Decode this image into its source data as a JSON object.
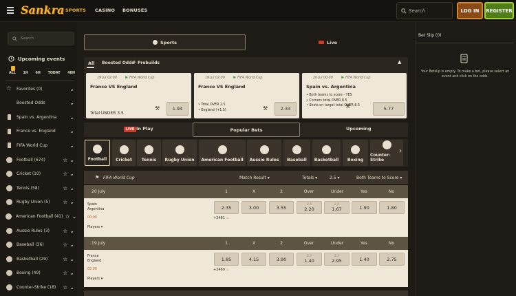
{
  "header": {
    "brand": "Sankra",
    "nav": [
      "SPORTS",
      "CASINO",
      "BONUSES"
    ],
    "search_placeholder": "Search",
    "login": "LOG IN",
    "register": "REGISTER"
  },
  "sidebar": {
    "search_placeholder": "Search",
    "upcoming_title": "Upcoming events",
    "filters": [
      "ALL",
      "1H",
      "6H",
      "TODAY",
      "48H"
    ],
    "items": [
      {
        "label": "Favorites (0)",
        "chev": true
      },
      {
        "label": "Boosted Odds"
      },
      {
        "label": "Spain vs. Argentina",
        "chev": true
      },
      {
        "label": "France vs. England",
        "chev": true
      },
      {
        "label": "FIFA World Cup",
        "chev": true
      },
      {
        "label": "Football (674)",
        "star": true
      },
      {
        "label": "Cricket (10)",
        "star": true
      },
      {
        "label": "Tennis (58)",
        "star": true
      },
      {
        "label": "Rugby Union (5)",
        "star": true
      },
      {
        "label": "American Football (41)",
        "star": true
      },
      {
        "label": "Aussie Rules (3)",
        "star": true
      },
      {
        "label": "Baseball (36)",
        "star": true
      },
      {
        "label": "Basketball (29)",
        "star": true
      },
      {
        "label": "Boxing (49)",
        "star": true
      },
      {
        "label": "Counter-Strike (18)",
        "star": true
      }
    ]
  },
  "main": {
    "tab_sports": "Sports",
    "tab_live": "Live",
    "subtabs": [
      "All",
      "Boosted Odds",
      "Prebuilds"
    ],
    "cards": [
      {
        "time": "19 Jul 02:00",
        "comp": "FIFA World Cup",
        "match": "France VS England",
        "foot": "Total UNDER 3.5",
        "odds": "1.94"
      },
      {
        "time": "19 Jul 02:00",
        "comp": "FIFA World Cup",
        "match": "France VS England",
        "lines": [
          "Total OVER 2.5",
          "England (+1.5)"
        ],
        "odds": "2.33"
      },
      {
        "time": "20 Jul 00:00",
        "comp": "FIFA World Cup",
        "match": "Spain vs. Argentina",
        "lines": [
          "Both teams to score - YES",
          "Corners total OVER 8.5",
          "Shots on target total OVER 8.5"
        ],
        "odds": "5.77"
      }
    ],
    "bettabs": {
      "live_badge": "LIVE",
      "in_play": "In Play",
      "popular": "Popular Bets",
      "upcoming": "Upcoming"
    },
    "sports": [
      "Football",
      "Cricket",
      "Tennis",
      "Rugby Union",
      "American Football",
      "Aussie Rules",
      "Baseball",
      "Basketball",
      "Boxing",
      "Counter-Strike"
    ],
    "table": {
      "league": "FIFA World Cup",
      "market": "Match Result",
      "totals": "Totals",
      "totals_line": "2.5",
      "btts": "Both Teams to Score",
      "cols": [
        "1",
        "X",
        "2",
        "Over",
        "Under",
        "Yes",
        "No"
      ],
      "groups": [
        {
          "date": "20 July",
          "home": "Spain",
          "away": "Argentina",
          "time": "00:00",
          "players": "Players",
          "more": "+2481",
          "odds": [
            "2.35",
            "3.00",
            "3.55",
            "2.20",
            "1.67",
            "1.90",
            "1.80"
          ],
          "lines": [
            "2.5",
            "2.5"
          ]
        },
        {
          "date": "19 July",
          "home": "France",
          "away": "England",
          "time": "02:00",
          "players": "Players",
          "more": "+2469",
          "odds": [
            "1.85",
            "4.15",
            "3.90",
            "1.40",
            "2.95",
            "1.40",
            "2.75"
          ],
          "lines": [
            "2.5",
            "2.5"
          ]
        }
      ]
    }
  },
  "betslip": {
    "title": "Bet Slip (0)",
    "empty": "Your Betslip is empty. To make a bet, please select an event and click on the odds."
  },
  "colors": {
    "accent": "#f2b52e",
    "bg": "#1e1b16",
    "card": "#efe7d8"
  }
}
